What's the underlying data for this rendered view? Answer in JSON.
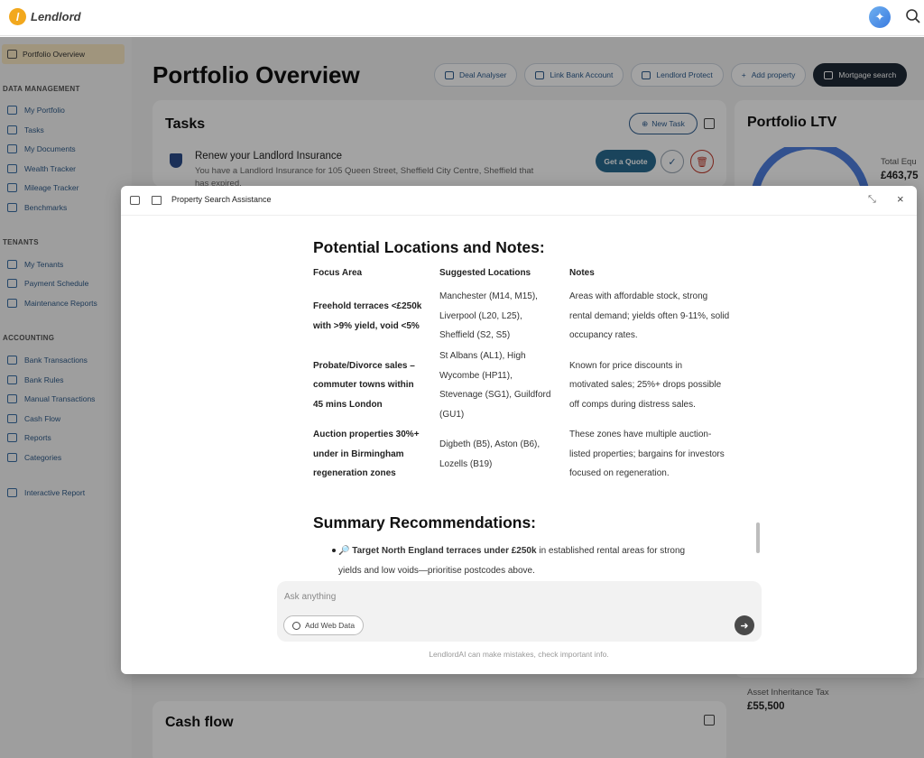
{
  "app": {
    "brand": "Lendlord"
  },
  "sidebar": {
    "active": "Portfolio Overview",
    "sections": [
      {
        "title": "DATA MANAGEMENT",
        "items": [
          "My Portfolio",
          "Tasks",
          "My Documents",
          "Wealth Tracker",
          "Mileage Tracker",
          "Benchmarks"
        ]
      },
      {
        "title": "TENANTS",
        "items": [
          "My Tenants",
          "Payment Schedule",
          "Maintenance Reports"
        ]
      },
      {
        "title": "ACCOUNTING",
        "items": [
          "Bank Transactions",
          "Bank Rules",
          "Manual Transactions",
          "Cash Flow",
          "Reports",
          "Categories"
        ]
      }
    ],
    "extra": "Interactive Report"
  },
  "main": {
    "title": "Portfolio Overview",
    "actions": [
      "Deal Analyser",
      "Link Bank Account",
      "Lendlord Protect",
      "Add property",
      "Mortgage search"
    ],
    "tasks": {
      "title": "Tasks",
      "new_task": "New Task",
      "item_title": "Renew your Landlord Insurance",
      "item_desc": "You have a Landlord Insurance for 105 Queen Street, Sheffield City Centre, Sheffield that has expired.",
      "quote": "Get a Quote"
    },
    "ltv": {
      "title": "Portfolio LTV",
      "equity_label": "Total Equ",
      "equity_value": "£463,75"
    },
    "iht": {
      "label": "Asset Inheritance Tax",
      "value": "£55,500"
    },
    "cashflow": {
      "title": "Cash flow"
    }
  },
  "modal": {
    "title": "Property Search Assistance",
    "heading": "Potential Locations and Notes:",
    "columns": [
      "Focus Area",
      "Suggested Locations",
      "Notes"
    ],
    "rows": [
      {
        "focus": [
          "Freehold terraces <£250k",
          "with >9% yield, void <5%"
        ],
        "locations": [
          "Manchester (M14, M15),",
          "Liverpool (L20, L25),",
          "Sheffield (S2, S5)"
        ],
        "notes": [
          "Areas with affordable stock, strong",
          "rental demand; yields often 9-11%, solid",
          "occupancy rates."
        ]
      },
      {
        "focus": [
          "Probate/Divorce sales –",
          "commuter towns within",
          "45 mins London"
        ],
        "locations": [
          "St Albans (AL1), High",
          "Wycombe (HP11),",
          "Stevenage (SG1), Guildford",
          "(GU1)"
        ],
        "notes": [
          "Known for price discounts in",
          "motivated sales; 25%+ drops possible",
          "off comps during distress sales."
        ]
      },
      {
        "focus": [
          "Auction properties 30%+",
          "under in Birmingham",
          "regeneration zones"
        ],
        "locations": [
          "Digbeth (B5), Aston (B6),",
          "Lozells (B19)"
        ],
        "notes": [
          "These zones have multiple auction-",
          "listed properties; bargains for investors",
          "focused on regeneration."
        ]
      }
    ],
    "summary_heading": "Summary Recommendations:",
    "bullet": {
      "icon": "🔎",
      "bold": "Target North England terraces under £250k",
      "text_line1": " in established rental areas for strong",
      "text_line2": "yields and low voids—prioritise postcodes above."
    },
    "input_placeholder": "Ask anything",
    "web_data": "Add Web Data",
    "disclaimer": "LendlordAI can make mistakes, check important info."
  }
}
